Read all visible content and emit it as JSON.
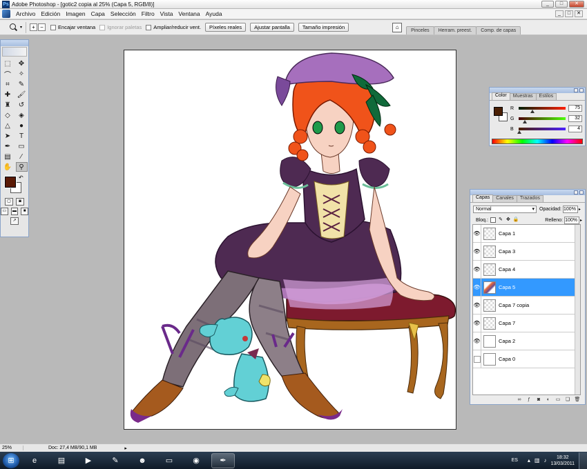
{
  "app": {
    "title": "Adobe Photoshop - [gotic2 copia al 25% (Capa 5, RGB/8)]",
    "app_icon": "Ps"
  },
  "window_controls": {
    "minimize": "_",
    "maximize": "□",
    "close": "✕"
  },
  "menu": [
    "Archivo",
    "Edición",
    "Imagen",
    "Capa",
    "Selección",
    "Filtro",
    "Vista",
    "Ventana",
    "Ayuda"
  ],
  "options": {
    "checkboxes": [
      {
        "label": "Encajar ventana",
        "checked": false,
        "disabled": false
      },
      {
        "label": "Ignorar paletas",
        "checked": false,
        "disabled": true
      },
      {
        "label": "Ampliar/reducir vent.",
        "checked": false,
        "disabled": false
      }
    ],
    "buttons": [
      "Píxeles reales",
      "Ajustar pantalla",
      "Tamaño impresión"
    ],
    "palette_well": [
      "Pinceles",
      "Herram. preest.",
      "Comp. de capas"
    ]
  },
  "toolbox": {
    "foreground_color": "#5a1a06",
    "background_color": "#ffffff",
    "tools": [
      {
        "icon": "marquee-icon",
        "glyph": "⬚"
      },
      {
        "icon": "move-icon",
        "glyph": "✥"
      },
      {
        "icon": "lasso-icon",
        "glyph": "⌒"
      },
      {
        "icon": "magic-wand-icon",
        "glyph": "✧"
      },
      {
        "icon": "crop-icon",
        "glyph": "⌗"
      },
      {
        "icon": "slice-icon",
        "glyph": "✎"
      },
      {
        "icon": "healing-brush-icon",
        "glyph": "✚"
      },
      {
        "icon": "brush-icon",
        "glyph": "🖌"
      },
      {
        "icon": "clone-stamp-icon",
        "glyph": "♜"
      },
      {
        "icon": "history-brush-icon",
        "glyph": "↺"
      },
      {
        "icon": "eraser-icon",
        "glyph": "◇"
      },
      {
        "icon": "paint-bucket-icon",
        "glyph": "◈"
      },
      {
        "icon": "blur-icon",
        "glyph": "△"
      },
      {
        "icon": "dodge-icon",
        "glyph": "●"
      },
      {
        "icon": "path-select-icon",
        "glyph": "➤"
      },
      {
        "icon": "type-icon",
        "glyph": "T"
      },
      {
        "icon": "pen-icon",
        "glyph": "✒"
      },
      {
        "icon": "shape-icon",
        "glyph": "▭"
      },
      {
        "icon": "notes-icon",
        "glyph": "▤"
      },
      {
        "icon": "eyedropper-icon",
        "glyph": "⁄"
      },
      {
        "icon": "hand-icon",
        "glyph": "✋"
      },
      {
        "icon": "zoom-tool-icon",
        "glyph": "⚲"
      }
    ]
  },
  "color_panel": {
    "tabs": [
      "Color",
      "Muestras",
      "Estilos"
    ],
    "sliders": [
      {
        "label": "R",
        "value": "75",
        "fraction": 0.294,
        "gradient": "linear-gradient(90deg,#002004,#ff2004)"
      },
      {
        "label": "G",
        "value": "32",
        "fraction": 0.125,
        "gradient": "linear-gradient(90deg,#4b0004,#4bff04)"
      },
      {
        "label": "B",
        "value": "4",
        "fraction": 0.016,
        "gradient": "linear-gradient(90deg,#4b2000,#4b20ff)"
      }
    ],
    "current_color": "#4b2004"
  },
  "layers_panel": {
    "tabs": [
      "Capas",
      "Canales",
      "Trazados"
    ],
    "blend_mode": "Normal",
    "opacity_label": "Opacidad:",
    "opacity": "100%",
    "lock_label": "Bloq.:",
    "fill_label": "Relleno:",
    "fill": "100%",
    "layers": [
      {
        "name": "Capa 1",
        "visible": true,
        "selected": false,
        "thumb": "transparent"
      },
      {
        "name": "Capa 3",
        "visible": true,
        "selected": false,
        "thumb": "transparent"
      },
      {
        "name": "Capa 4",
        "visible": true,
        "selected": false,
        "thumb": "transparent"
      },
      {
        "name": "Capa 5",
        "visible": true,
        "selected": true,
        "thumb": "art"
      },
      {
        "name": "Capa 7 copia",
        "visible": true,
        "selected": false,
        "thumb": "transparent"
      },
      {
        "name": "Capa 7",
        "visible": true,
        "selected": false,
        "thumb": "transparent"
      },
      {
        "name": "Capa 2",
        "visible": true,
        "selected": false,
        "thumb": "white"
      },
      {
        "name": "Capa 0",
        "visible": false,
        "selected": false,
        "thumb": "sketch"
      }
    ]
  },
  "status": {
    "zoom": "25%",
    "doc_size": "Doc: 27,4 MB/90,1 MB"
  },
  "taskbar": {
    "lang": "ES",
    "time": "18:32",
    "date": "13/03/2011"
  }
}
